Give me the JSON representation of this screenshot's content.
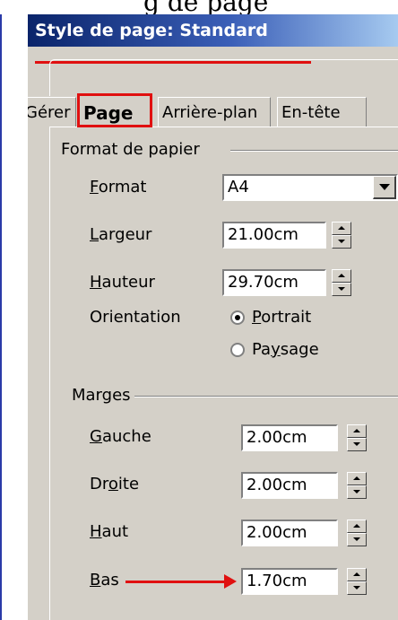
{
  "caption": "g de page",
  "dialog": {
    "title": "Style de page: Standard",
    "tabs": [
      "Gérer",
      "Page",
      "Arrière-plan",
      "En-tête"
    ],
    "active_tab": "Page"
  },
  "paper": {
    "group": "Format de papier",
    "format_label": "Format",
    "format_value": "A4",
    "width_label": "Largeur",
    "width_value": "21.00cm",
    "height_label": "Hauteur",
    "height_value": "29.70cm",
    "orientation_label": "Orientation",
    "portrait_label": "Portrait",
    "landscape_label": "Paysage",
    "orientation_selected": "Portrait"
  },
  "margins": {
    "group": "Marges",
    "left_label": "Gauche",
    "left_value": "2.00cm",
    "right_label": "Droite",
    "right_value": "2.00cm",
    "top_label": "Haut",
    "top_value": "2.00cm",
    "bottom_label": "Bas",
    "bottom_value": "1.70cm"
  },
  "colors": {
    "highlight": "#e01010",
    "titlebar": "#0a246a",
    "dialog_bg": "#d4d0c8"
  }
}
